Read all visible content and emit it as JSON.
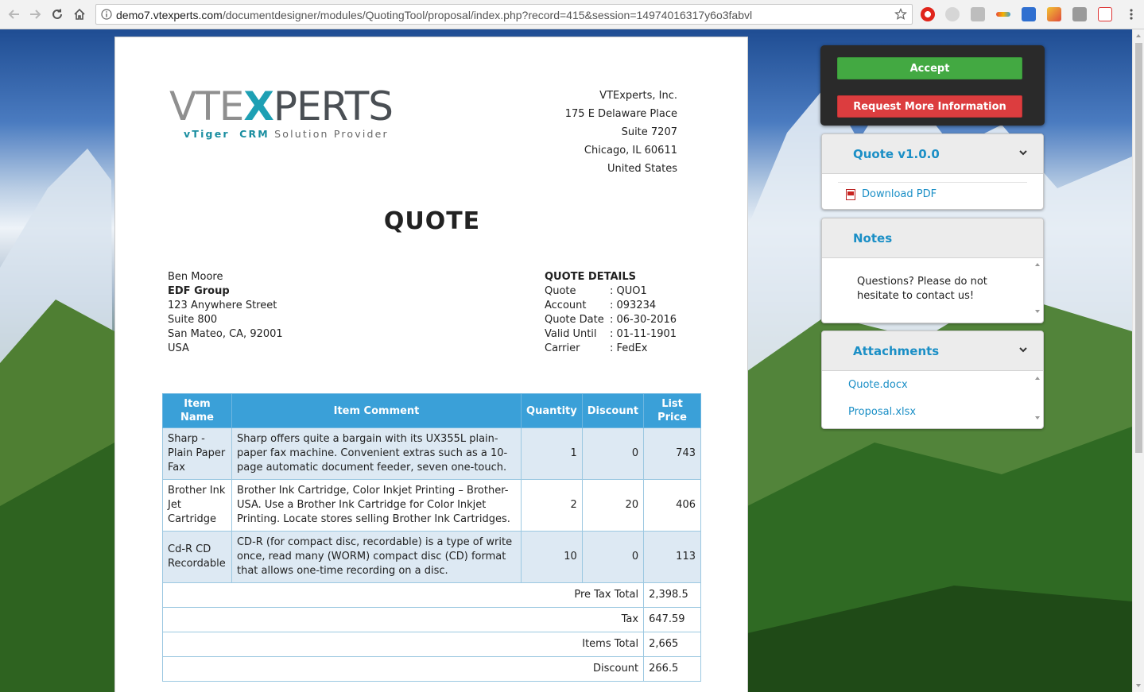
{
  "browser": {
    "url_host": "demo7.vtexperts.com",
    "url_path": "/documentdesigner/modules/QuotingTool/proposal/index.php?record=415&session=14974016317y6o3fabvl"
  },
  "logo": {
    "main_left": "VTE",
    "main_x": "X",
    "main_right": "PERTS",
    "sub_brand": "vTiger",
    "sub_crm": "CRM",
    "sub_rest": "Solution Provider"
  },
  "company": {
    "name": "VTExperts, Inc.",
    "street": "175 E Delaware Place",
    "suite": "Suite 7207",
    "city": "Chicago, IL 60611",
    "country": "United States"
  },
  "document_title": "QUOTE",
  "bill_to": {
    "contact": "Ben Moore",
    "company": "EDF Group",
    "street": "123 Anywhere Street",
    "suite": "Suite 800",
    "city": "San Mateo, CA, 92001",
    "country": "USA"
  },
  "quote_details": {
    "heading": "QUOTE DETAILS",
    "quote_label": "Quote",
    "quote_value": ": QUO1",
    "account_label": "Account",
    "account_value": ": 093234",
    "date_label": "Quote Date",
    "date_value": ": 06-30-2016",
    "valid_label": "Valid Until",
    "valid_value": ": 01-11-1901",
    "carrier_label": "Carrier",
    "carrier_value": ": FedEx"
  },
  "table": {
    "headers": [
      "Item Name",
      "Item Comment",
      "Quantity",
      "Discount",
      "List Price"
    ],
    "rows": [
      {
        "name": "Sharp - Plain Paper Fax",
        "comment": "Sharp offers quite a bargain with its UX355L plain-paper fax machine. Convenient extras such as a 10-page automatic document feeder, seven one-touch.",
        "quantity": "1",
        "discount": "0",
        "price": "743"
      },
      {
        "name": "Brother Ink Jet Cartridge",
        "comment": "Brother Ink Cartridge, Color Inkjet Printing – Brother-USA. Use a Brother Ink Cartridge for Color Inkjet Printing. Locate stores selling Brother Ink Cartridges.",
        "quantity": "2",
        "discount": "20",
        "price": "406"
      },
      {
        "name": "Cd-R CD Recordable",
        "comment": "CD-R (for compact disc, recordable) is a type of write once, read many (WORM) compact disc (CD) format that allows one-time recording on a disc.",
        "quantity": "10",
        "discount": "0",
        "price": "113"
      }
    ],
    "totals": [
      {
        "label": "Pre Tax Total",
        "value": "2,398.5"
      },
      {
        "label": "Tax",
        "value": "647.59"
      },
      {
        "label": "Items Total",
        "value": "2,665"
      },
      {
        "label": "Discount",
        "value": "266.5"
      }
    ]
  },
  "sidebar": {
    "accept_label": "Accept",
    "request_label": "Request More Information",
    "quote_panel_title": "Quote v1.0.0",
    "download_label": "Download PDF",
    "notes_title": "Notes",
    "notes_text": "Questions? Please do not hesitate to contact us!",
    "attachments_title": "Attachments",
    "attachments": [
      "Quote.docx",
      "Proposal.xlsx"
    ]
  },
  "colors": {
    "accent": "#1b8fc6",
    "table_header": "#3aa0d8",
    "accept": "#43a942",
    "request": "#dc3d3f"
  },
  "icons": [
    "back-icon",
    "forward-icon",
    "reload-icon",
    "home-icon",
    "info-icon",
    "star-icon",
    "pdf-icon",
    "chevron-down-icon"
  ]
}
